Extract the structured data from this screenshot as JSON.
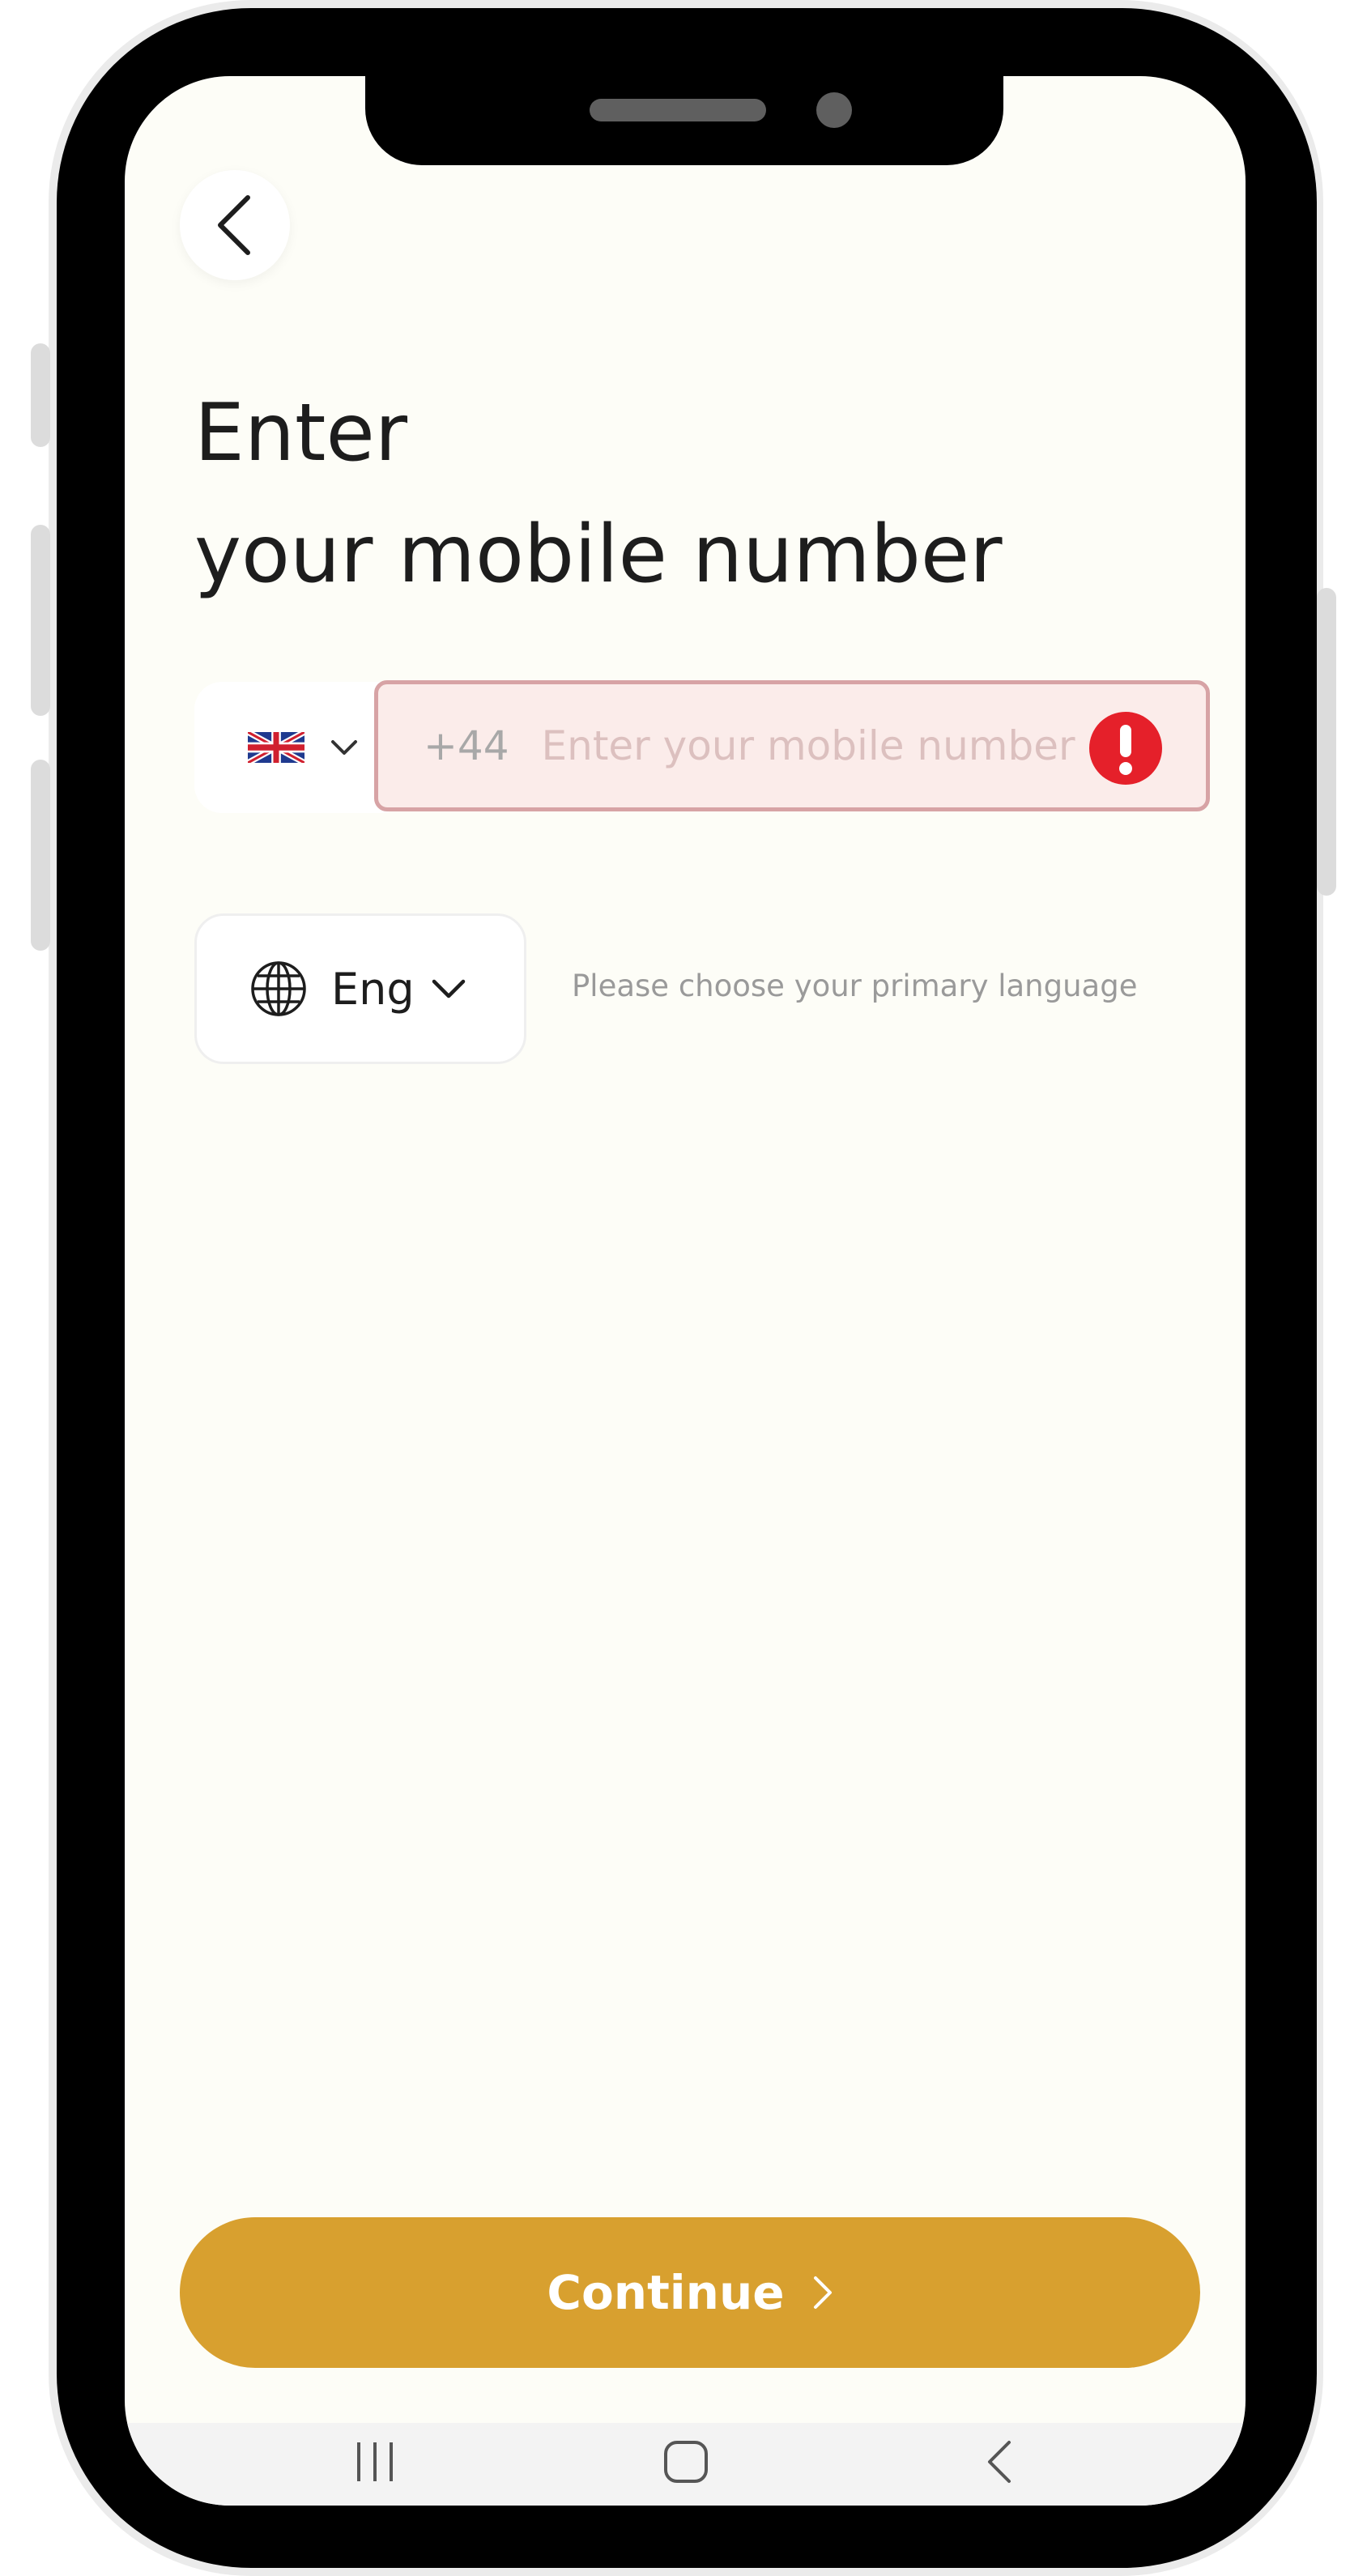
{
  "header": {
    "back_icon": "chevron-left-icon",
    "title_line1": "Enter",
    "title_line2": "your mobile number"
  },
  "phone": {
    "country_flag": "uk-flag-icon",
    "dial_code": "+44",
    "placeholder": "Enter your mobile number",
    "value": "",
    "error_icon": "exclamation-circle-icon",
    "error_color": "#e5202a"
  },
  "language": {
    "globe_icon": "globe-icon",
    "selected": "Eng",
    "hint": "Please choose your primary language"
  },
  "actions": {
    "continue_label": "Continue",
    "continue_color": "#d8a02f"
  },
  "system_nav": {
    "recents_icon": "recents-icon",
    "home_icon": "home-icon",
    "back_icon": "back-icon"
  },
  "colors": {
    "background": "#fdfdf7",
    "error_border": "#d7a3a5",
    "error_fill": "#fbecea"
  }
}
